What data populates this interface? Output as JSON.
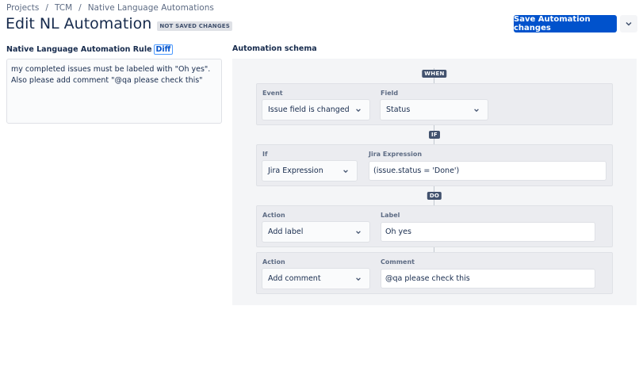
{
  "breadcrumb": [
    {
      "label": "Projects"
    },
    {
      "label": "TCM"
    },
    {
      "label": "Native Language Automations"
    }
  ],
  "breadcrumb_separator": "/",
  "page": {
    "title": "Edit NL Automation",
    "badge": "NOT SAVED CHANGES"
  },
  "toolbar": {
    "save_label": "Save Automation changes",
    "more_icon": "chevron-down-icon"
  },
  "rule": {
    "label": "Native Language Automation Rule",
    "diff_label": "Diff",
    "text": "my completed issues must be labeled with \"Oh yes\". Also please add comment \"@qa please check this\""
  },
  "schema": {
    "label": "Automation schema",
    "when_tag": "WHEN",
    "if_tag": "IF",
    "do_tag": "DO",
    "trigger": {
      "event_label": "Event",
      "event_value": "Issue field is changed",
      "field_label": "Field",
      "field_value": "Status"
    },
    "condition": {
      "if_label": "If",
      "if_value": "Jira Expression",
      "expr_label": "Jira Expression",
      "expr_value": "(issue.status = 'Done')"
    },
    "actions": [
      {
        "action_label": "Action",
        "action_value": "Add label",
        "param_label": "Label",
        "param_value": "Oh yes"
      },
      {
        "action_label": "Action",
        "action_value": "Add comment",
        "param_label": "Comment",
        "param_value": "@qa please check this"
      }
    ]
  },
  "colors": {
    "primary": "#0052cc",
    "tag_bg": "#42526e",
    "panel_bg": "#f4f5f7"
  }
}
